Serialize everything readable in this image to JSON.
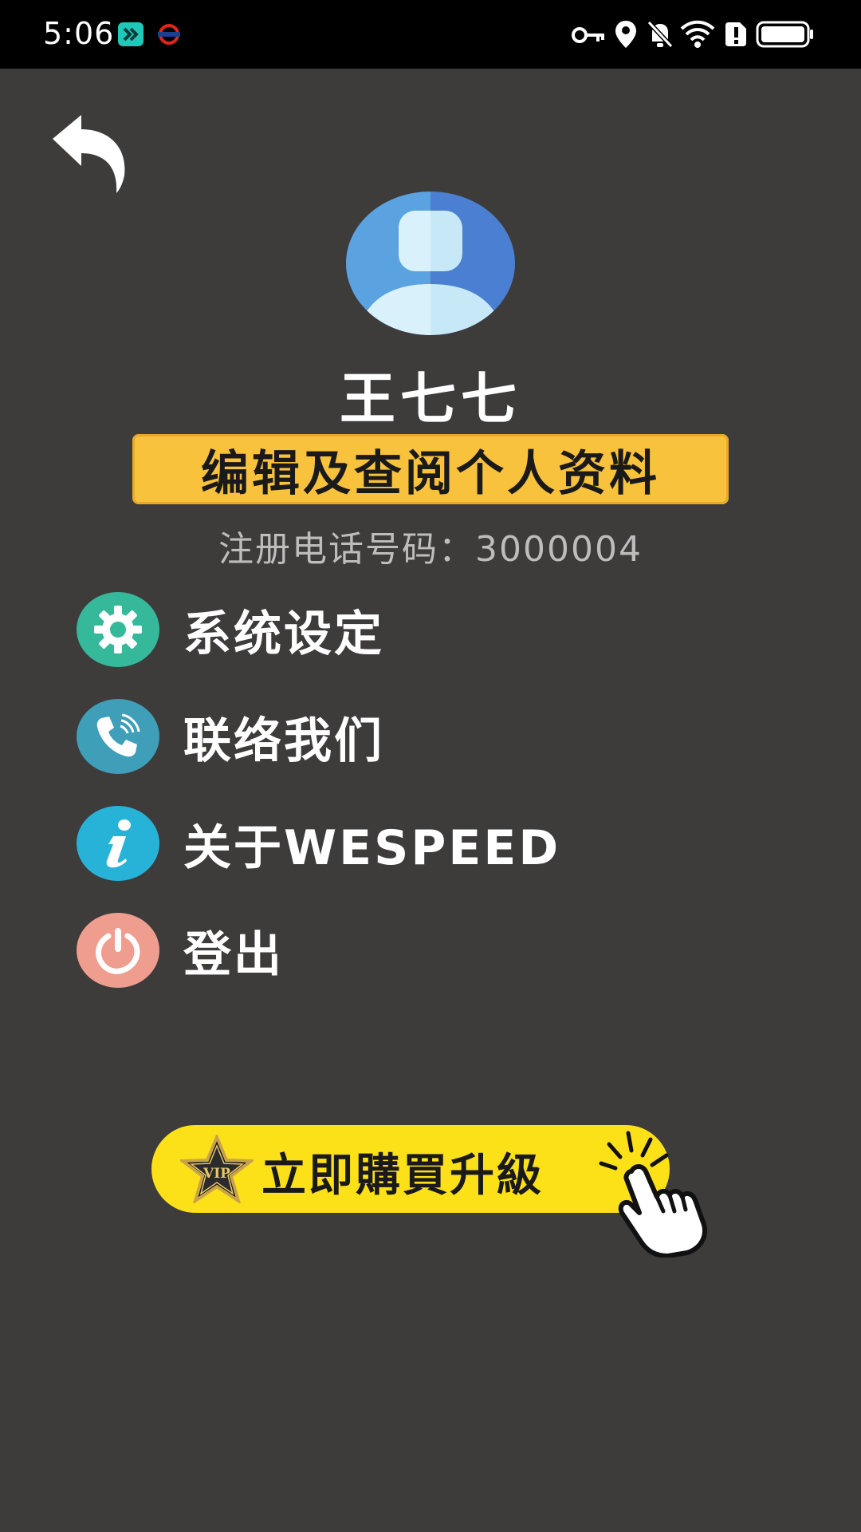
{
  "status_bar": {
    "time": "5:06",
    "left_icons": [
      "double-chevron-app-icon",
      "metro-logo-icon"
    ],
    "right_icons": [
      "key-icon",
      "location-icon",
      "notifications-off-icon",
      "wifi-icon",
      "alert-icon",
      "battery-icon"
    ]
  },
  "profile": {
    "name": "王七七",
    "edit_button_label": "编辑及查阅个人资料",
    "phone_text": "注册电话号码：3000004"
  },
  "menu": [
    {
      "label": "系统设定",
      "icon": "gear-icon",
      "color": "#35b99a"
    },
    {
      "label": "联络我们",
      "icon": "phone-icon",
      "color": "#3f9eb8"
    },
    {
      "label": "关于WESPEED",
      "icon": "info-icon",
      "color": "#27b3d8"
    },
    {
      "label": "登出",
      "icon": "power-icon",
      "color": "#ee9d8f"
    }
  ],
  "upgrade": {
    "label": "立即購買升級",
    "badge_text": "VIP"
  },
  "colors": {
    "background": "#3e3b3b",
    "edit_button": "#f9c23c",
    "vip_button": "#fce119",
    "phone_text": "#bdbdbd"
  }
}
